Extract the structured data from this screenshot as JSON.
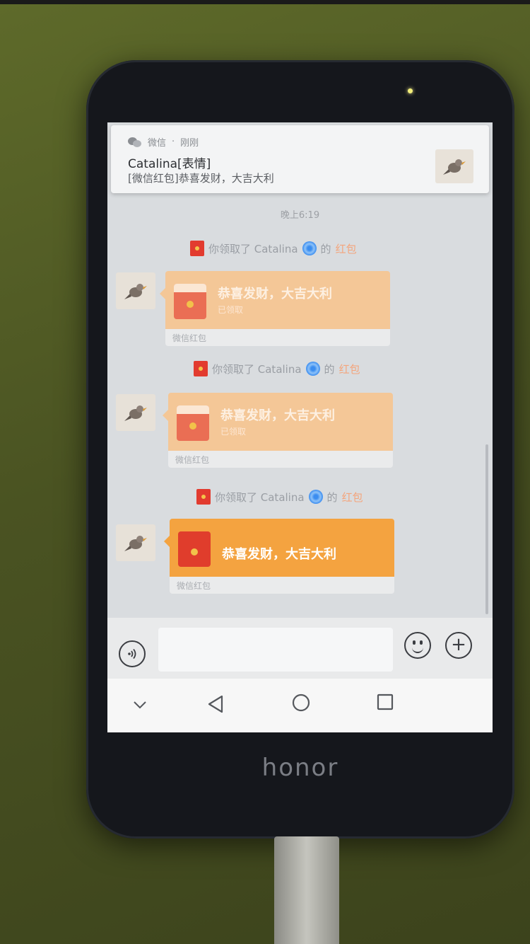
{
  "device": {
    "brand": "honor"
  },
  "notification": {
    "app": "微信",
    "when": "刚刚",
    "title": "Catalina[表情]",
    "body": "[微信红包]恭喜发财，大吉大利"
  },
  "chat": {
    "time": "晚上6:19",
    "system_messages": [
      {
        "prefix": "你领取了 Catalina",
        "suffix": "的",
        "link": "红包"
      },
      {
        "prefix": "你领取了 Catalina",
        "suffix": "的",
        "link": "红包"
      },
      {
        "prefix": "你领取了 Catalina",
        "suffix": "的",
        "link": "红包"
      }
    ],
    "packets": [
      {
        "message": "恭喜发财，大吉大利",
        "status": "已领取",
        "footer": "微信红包"
      },
      {
        "message": "恭喜发财，大吉大利",
        "status": "已领取",
        "footer": "微信红包"
      },
      {
        "message": "恭喜发财，大吉大利",
        "status": "",
        "footer": "微信红包"
      }
    ]
  },
  "icons": {
    "voice": "voice-icon",
    "emoji": "emoji-icon",
    "plus": "plus-icon",
    "nav": [
      "chevron-down-icon",
      "back-icon",
      "home-icon",
      "recents-icon"
    ]
  },
  "colors": {
    "packet_fresh": "#f4a340",
    "packet_opened": "#f4c797",
    "link": "#f4a57c"
  }
}
